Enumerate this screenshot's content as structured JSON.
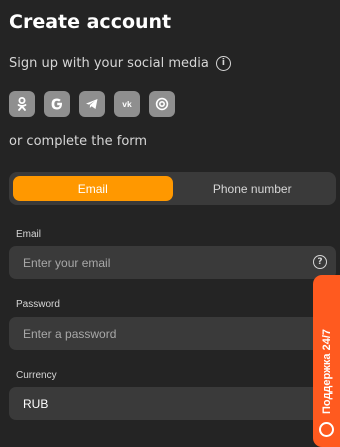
{
  "title": "Create account",
  "social": {
    "label": "Sign up with your social media",
    "icons": [
      "odnoklassniki-icon",
      "google-icon",
      "telegram-icon",
      "vk-icon",
      "mailru-icon"
    ]
  },
  "or_text": "or complete the form",
  "tabs": [
    {
      "label": "Email",
      "active": true
    },
    {
      "label": "Phone number",
      "active": false
    }
  ],
  "form": {
    "email": {
      "label": "Email",
      "placeholder": "Enter your email"
    },
    "password": {
      "label": "Password",
      "placeholder": "Enter a password"
    },
    "currency": {
      "label": "Currency",
      "value": "RUB"
    }
  },
  "support": {
    "label": "Поддержка 24/7"
  },
  "colors": {
    "background": "#242424",
    "field": "#3a3a3a",
    "accent": "#ff9800",
    "support": "#ff5a1f",
    "social_button": "#8f8f8f"
  }
}
